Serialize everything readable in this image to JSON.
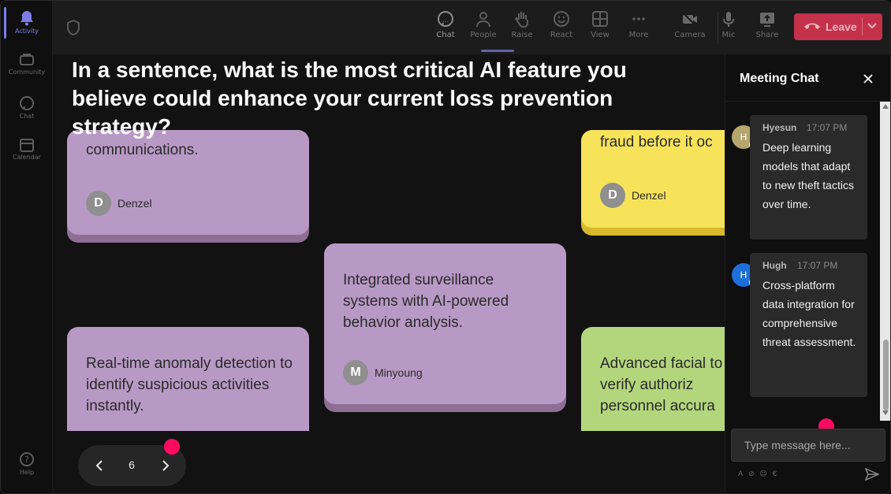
{
  "rail": {
    "items": [
      {
        "label": "Activity",
        "icon": "bell-icon"
      },
      {
        "label": "Community",
        "icon": "community-icon"
      },
      {
        "label": "Chat",
        "icon": "chat-icon"
      },
      {
        "label": "Calendar",
        "icon": "calendar-icon"
      },
      {
        "label": "Help",
        "icon": "help-icon"
      }
    ]
  },
  "toolbar": {
    "chat": "Chat",
    "people": "People",
    "raise": "Raise",
    "react": "React",
    "view": "View",
    "more": "More",
    "camera": "Camera",
    "mic": "Mic",
    "share": "Share",
    "leave": "Leave"
  },
  "question": "In a sentence, what is the most critical AI feature you believe could enhance your current loss prevention strategy?",
  "cards": [
    {
      "text": "communications.",
      "author": "Denzel",
      "initial": "D",
      "color": "purple"
    },
    {
      "text": "fraud before it oc",
      "author": "Denzel",
      "initial": "D",
      "color": "yellow"
    },
    {
      "text": "Integrated surveillance systems with AI-powered behavior analysis.",
      "author": "Minyoung",
      "initial": "M",
      "color": "purple"
    },
    {
      "text": "Real-time anomaly detection to identify suspicious activities instantly.",
      "author": "",
      "initial": "",
      "color": "purple"
    },
    {
      "text": "Advanced facial to verify authoriz personnel accura",
      "author": "",
      "initial": "",
      "color": "green"
    }
  ],
  "pager": {
    "page": "6"
  },
  "chat": {
    "title": "Meeting Chat",
    "messages": [
      {
        "author": "Hyesun",
        "time": "17:07 PM",
        "initial": "H",
        "text": "Deep learning models that adapt to new theft tactics over time.",
        "avatar_color": "#b5a66e"
      },
      {
        "author": "Hugh",
        "time": "17:07 PM",
        "initial": "H",
        "text": "Cross-platform data integration for comprehensive threat assessment.",
        "avatar_color": "#1e6fd9"
      }
    ],
    "placeholder": "Type message here...",
    "tools": "A ⊘ ☺ €"
  },
  "colors": {
    "accent": "#6264a7",
    "leave": "#c4314b",
    "marker": "#ff0a61"
  }
}
